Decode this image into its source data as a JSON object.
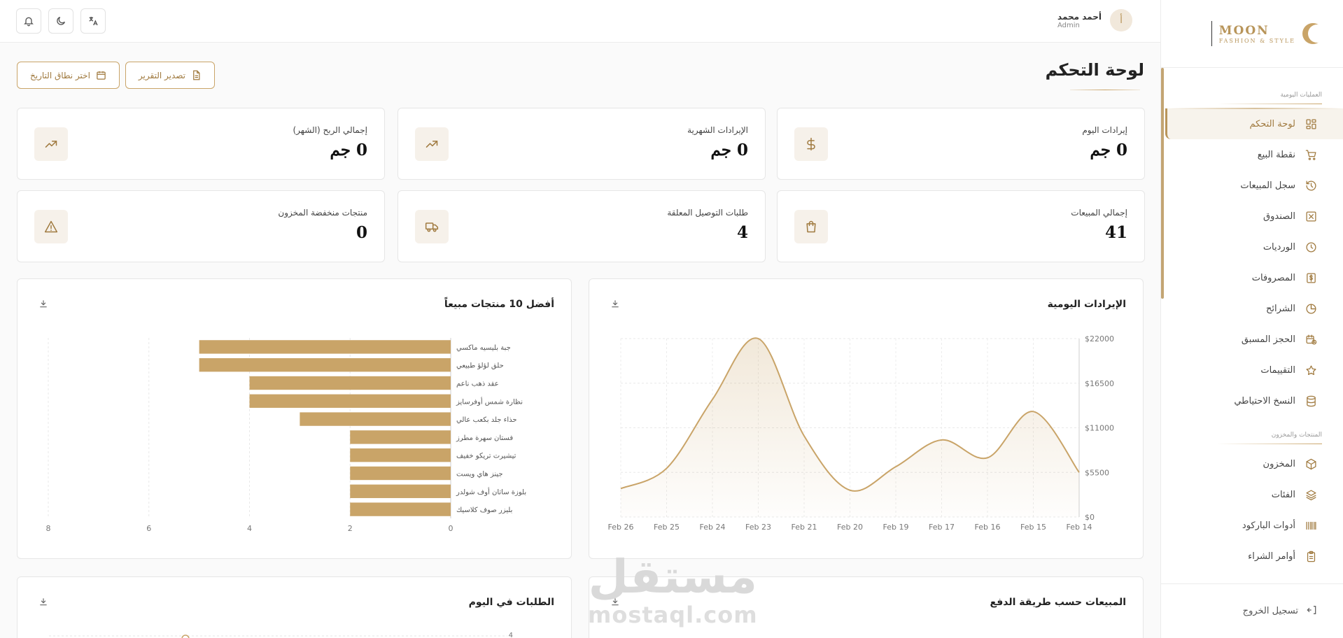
{
  "brand": {
    "name": "MOON",
    "tagline": "FASHION & STYLE"
  },
  "user": {
    "initial": "أ",
    "name": "أحمد محمد",
    "role": "Admin"
  },
  "sidebar": {
    "section_daily": "العمليات اليومية",
    "items_daily": [
      {
        "label": "لوحة التحكم",
        "icon": "dashboard-icon",
        "active": true
      },
      {
        "label": "نقطة البيع",
        "icon": "cart-icon"
      },
      {
        "label": "سجل المبيعات",
        "icon": "history-icon"
      },
      {
        "label": "الصندوق",
        "icon": "cash-box-icon"
      },
      {
        "label": "الورديات",
        "icon": "clock-icon"
      },
      {
        "label": "المصروفات",
        "icon": "expense-icon"
      },
      {
        "label": "الشرائح",
        "icon": "pie-icon"
      },
      {
        "label": "الحجز المسبق",
        "icon": "calendar-clock-icon"
      },
      {
        "label": "التقييمات",
        "icon": "star-icon"
      },
      {
        "label": "النسخ الاحتياطي",
        "icon": "database-icon"
      }
    ],
    "section_products": "المنتجات والمخزون",
    "items_products": [
      {
        "label": "المخزون",
        "icon": "box-icon"
      },
      {
        "label": "الفئات",
        "icon": "layers-icon"
      },
      {
        "label": "أدوات الباركود",
        "icon": "barcode-icon"
      },
      {
        "label": "أوامر الشراء",
        "icon": "clipboard-icon"
      }
    ],
    "logout": "تسجيل الخروج"
  },
  "page": {
    "title": "لوحة التحكم",
    "export_label": "تصدير التقرير",
    "date_range_label": "اختر نطاق التاريخ"
  },
  "stats": [
    {
      "label": "إيرادات اليوم",
      "value": "0 جم",
      "icon": "dollar-icon"
    },
    {
      "label": "الإيرادات الشهرية",
      "value": "0 جم",
      "icon": "trending-up-icon"
    },
    {
      "label": "إجمالي الربح (الشهر)",
      "value": "0 جم",
      "icon": "trending-up-icon"
    },
    {
      "label": "إجمالي المبيعات",
      "value": "41",
      "icon": "shopping-bag-icon"
    },
    {
      "label": "طلبات التوصيل المعلقة",
      "value": "4",
      "icon": "truck-icon"
    },
    {
      "label": "منتجات منخفضة المخزون",
      "value": "0",
      "icon": "alert-triangle-icon"
    }
  ],
  "charts_titles": {
    "daily_revenue": "الإيرادات اليومية",
    "top_products": "أفضل 10 منتجات مبيعاً",
    "payment_method": "المبيعات حسب طريقة الدفع",
    "orders_today": "الطلبات في اليوم"
  },
  "watermark": {
    "ar": "مستقل",
    "en": "mostaql.com"
  },
  "colors": {
    "accent": "#b8955a",
    "bar": "#c9a468",
    "line": "#c9a468"
  },
  "chart_data": [
    {
      "type": "area",
      "title": "الإيرادات اليومية",
      "x": [
        "Feb 26",
        "Feb 25",
        "Feb 24",
        "Feb 23",
        "Feb 21",
        "Feb 20",
        "Feb 19",
        "Feb 17",
        "Feb 16",
        "Feb 15",
        "Feb 14"
      ],
      "values": [
        3500,
        6000,
        14500,
        22000,
        10000,
        3300,
        6200,
        9500,
        7300,
        13000,
        5500
      ],
      "y_ticks": [
        "$0",
        "$5500",
        "$11000",
        "$16500",
        "$22000"
      ],
      "ylim": [
        0,
        22000
      ],
      "grid": true
    },
    {
      "type": "bar",
      "orientation": "horizontal",
      "title": "أفضل 10 منتجات مبيعاً",
      "categories": [
        "جبة بليسيه ماكسي",
        "حلق لؤلؤ طبيعي",
        "عقد ذهب ناعم",
        "نظارة شمس أوفرسايز",
        "حذاء جلد بكعب عالي",
        "فستان سهرة مطرز",
        "تيشيرت تريكو خفيف",
        "جينز هاي ويست",
        "بلوزة ساتان أوف شولدر",
        "بليزر صوف كلاسيك"
      ],
      "values": [
        5,
        5,
        4,
        4,
        3,
        2,
        2,
        2,
        2,
        2
      ],
      "x_ticks": [
        "0",
        "2",
        "4",
        "6",
        "8"
      ],
      "xlim": [
        0,
        8
      ],
      "grid": true
    }
  ],
  "orders_chart_partial_tick": "4"
}
